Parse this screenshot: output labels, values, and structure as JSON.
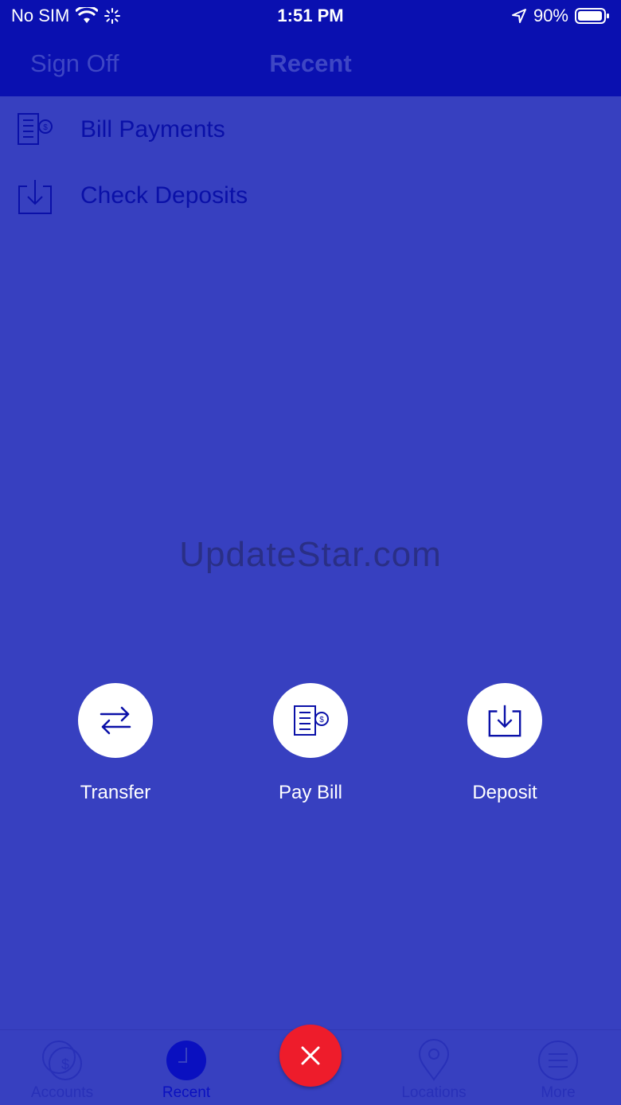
{
  "status_bar": {
    "carrier": "No SIM",
    "time": "1:51 PM",
    "battery": "90%"
  },
  "nav": {
    "left_button": "Sign Off",
    "title": "Recent"
  },
  "recent_items": [
    {
      "label": "Bill Payments",
      "icon": "bill-payment-icon"
    },
    {
      "label": "Check Deposits",
      "icon": "deposit-tray-icon"
    }
  ],
  "watermark": "UpdateStar.com",
  "actions": [
    {
      "label": "Transfer",
      "icon": "transfer-arrows-icon"
    },
    {
      "label": "Pay Bill",
      "icon": "bill-payment-icon"
    },
    {
      "label": "Deposit",
      "icon": "deposit-tray-icon"
    }
  ],
  "tabs": [
    {
      "label": "Accounts",
      "icon": "coins-icon"
    },
    {
      "label": "Recent",
      "icon": "clock-icon",
      "active": true
    },
    {
      "label": "Locations",
      "icon": "location-pin-icon"
    },
    {
      "label": "More",
      "icon": "menu-icon"
    }
  ],
  "colors": {
    "background": "#3740c0",
    "header": "#0a10b0",
    "close_button": "#ee1c2b",
    "white": "#ffffff"
  }
}
